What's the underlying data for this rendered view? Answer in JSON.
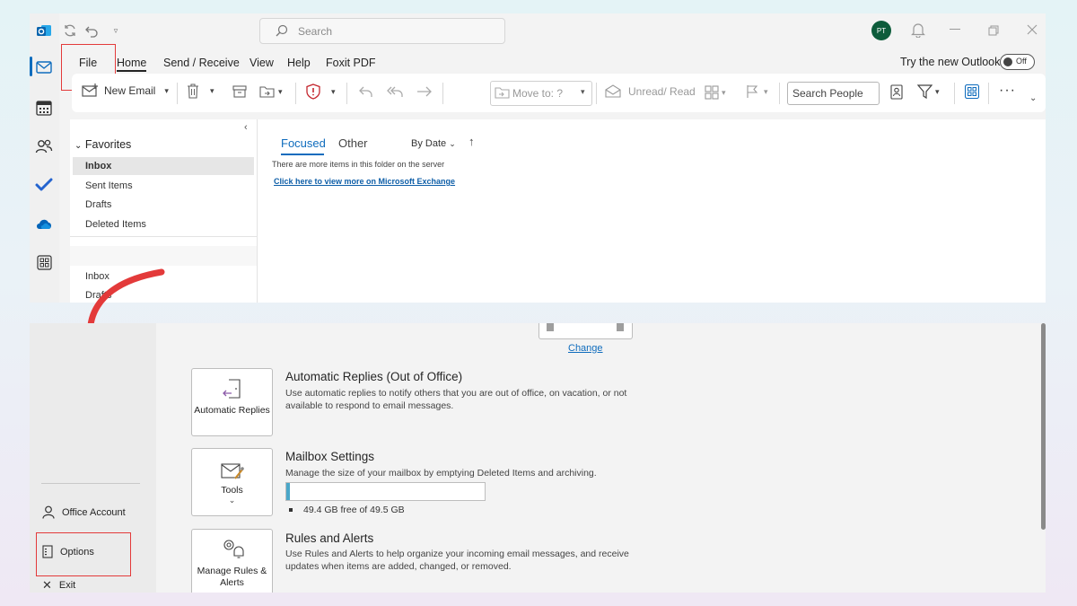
{
  "top": {
    "search_placeholder": "Search",
    "avatar_initials": "PT",
    "menu_tabs": [
      "File",
      "Home",
      "Send / Receive",
      "View",
      "Help",
      "Foxit PDF"
    ],
    "try_new_outlook": "Try the new Outlook",
    "toggle_label": "Off",
    "ribbon": {
      "new_email": "New Email",
      "move_to": "Move to: ?",
      "unread_read": "Unread/ Read",
      "search_people": "Search People"
    },
    "folders": {
      "favorites": "Favorites",
      "items": [
        "Inbox",
        "Sent Items",
        "Drafts",
        "Deleted Items"
      ],
      "second_group": [
        "Inbox",
        "Drafts"
      ]
    },
    "message_list": {
      "tab_focused": "Focused",
      "tab_other": "Other",
      "sort": "By Date",
      "server_notice": "There are more items in this folder on the server",
      "exchange_link": "Click here to view more on Microsoft Exchange"
    }
  },
  "bottom": {
    "change_link": "Change",
    "nav": {
      "office_account": "Office Account",
      "options": "Options",
      "exit": "Exit"
    },
    "sections": [
      {
        "tile_label": "Automatic Replies",
        "title": "Automatic Replies (Out of Office)",
        "description": "Use automatic replies to notify others that you are out of office, on vacation, or not available to respond to email messages."
      },
      {
        "tile_label": "Tools",
        "title": "Mailbox Settings",
        "description": "Manage the size of your mailbox by emptying Deleted Items and archiving.",
        "quota_text": "49.4 GB free of 49.5 GB",
        "quota_used_fraction": 0.02
      },
      {
        "tile_label": "Manage Rules & Alerts",
        "title": "Rules and Alerts",
        "description": "Use Rules and Alerts to help organize your incoming email messages, and receive updates when items are added, changed, or removed."
      }
    ]
  },
  "colors": {
    "accent": "#0f6cbd",
    "highlight_box": "#e33a3a",
    "arrow": "#e33a3a",
    "avatar_bg": "#0d5c3b",
    "quota_fill": "#4aa7c9"
  }
}
